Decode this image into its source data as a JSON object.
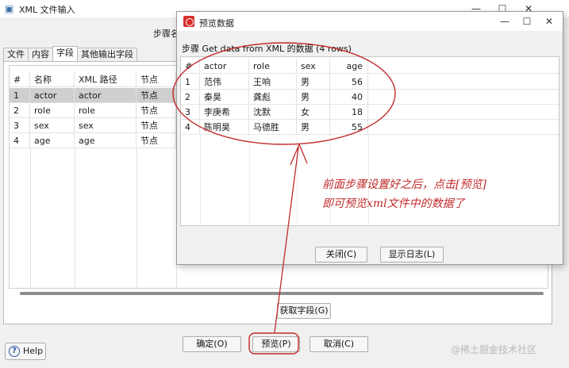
{
  "main_window": {
    "title": "XML 文件输入",
    "step_name_label": "步骤名",
    "controls": {
      "minimize": "—",
      "maximize": "☐",
      "close": "✕"
    },
    "tabs": [
      "文件",
      "内容",
      "字段",
      "其他输出字段"
    ],
    "active_tab": "字段",
    "fields_table": {
      "columns": [
        "#",
        "名称",
        "XML 路径",
        "节点"
      ],
      "rows": [
        [
          "1",
          "actor",
          "actor",
          "节点"
        ],
        [
          "2",
          "role",
          "role",
          "节点"
        ],
        [
          "3",
          "sex",
          "sex",
          "节点"
        ],
        [
          "4",
          "age",
          "age",
          "节点"
        ]
      ]
    },
    "get_fields_button": "获取字段(G)",
    "ok_button": "确定(O)",
    "preview_button": "预览(P)",
    "cancel_button": "取消(C)",
    "help_button": "Help"
  },
  "preview_dialog": {
    "title": "预览数据",
    "controls": {
      "minimize": "—",
      "maximize": "☐",
      "close": "✕"
    },
    "label": "步骤 Get data from XML 的数据  (4 rows)",
    "columns": [
      "#",
      "actor",
      "role",
      "sex",
      "age"
    ],
    "rows": [
      [
        "1",
        "范伟",
        "王响",
        "男",
        "56"
      ],
      [
        "2",
        "秦昊",
        "龚彪",
        "男",
        "40"
      ],
      [
        "3",
        "李庚希",
        "沈默",
        "女",
        "18"
      ],
      [
        "4",
        "陈明昊",
        "马德胜",
        "男",
        "55"
      ]
    ],
    "close_button": "关闭(C)",
    "show_log_button": "显示日志(L)"
  },
  "annotation": {
    "line1": "前面步骤设置好之后，点击[预览]",
    "line2": "即可预览xml文件中的数据了",
    "color": "#c12a2a"
  },
  "watermark": "@稀土掘金技术社区"
}
